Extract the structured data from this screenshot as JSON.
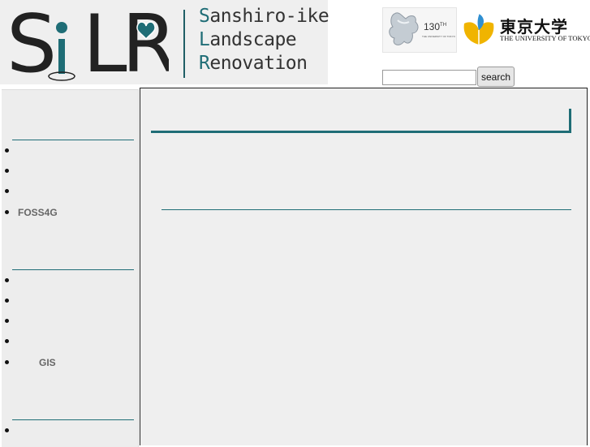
{
  "header": {
    "logo_letters": [
      "S",
      "i",
      "L",
      "R"
    ],
    "logo_lines": [
      {
        "cap": "S",
        "rest": "anshiro-ike"
      },
      {
        "cap": "L",
        "rest": "andscape"
      },
      {
        "cap": "R",
        "rest": "enovation"
      }
    ],
    "anniversary_number": "130",
    "anniversary_sup": "TH",
    "anniversary_sub": "THE UNIVERSITY OF TOKYO",
    "university_kanji": "東京大学",
    "university_en": "THE UNIVERSITY OF TOKYO"
  },
  "search": {
    "value": "",
    "button_label": "search"
  },
  "sidebar": {
    "sections": [
      {
        "items": [
          "",
          "",
          "",
          "FOSS4G"
        ]
      },
      {
        "items": [
          "",
          "",
          "",
          "",
          "GIS"
        ]
      },
      {
        "items": [
          ""
        ]
      }
    ]
  },
  "colors": {
    "accent": "#1f6d76",
    "panel_bg": "#efefef",
    "text_muted": "#666666"
  }
}
